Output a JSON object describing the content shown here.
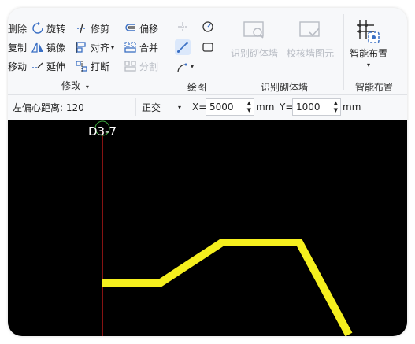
{
  "ribbon": {
    "modify": {
      "delete": "删除",
      "rotate": "旋转",
      "trim": "修剪",
      "offset": "偏移",
      "copy": "复制",
      "mirror": "镜像",
      "align": "对齐",
      "merge": "合并",
      "move": "移动",
      "extend": "延伸",
      "break": "打断",
      "split": "分割",
      "group_label": "修改"
    },
    "draw": {
      "group_label": "绘图"
    },
    "wall": {
      "identify_wall": "识别砌体墙",
      "check_wall": "校核墙图元",
      "group_label": "识别砌体墙"
    },
    "layout": {
      "smart_layout": "智能布置",
      "group_label": "智能布置"
    }
  },
  "options": {
    "offset_label": "左偏心距离: 120",
    "mode": "正交",
    "x_label": "X=",
    "x_value": "5000",
    "x_unit": "mm",
    "y_label": "Y=",
    "y_value": "1000",
    "y_unit": "mm"
  },
  "canvas": {
    "axis_label": "D3-7",
    "axis_color": "#e0201f",
    "wall_color": "#f5ef1e"
  }
}
